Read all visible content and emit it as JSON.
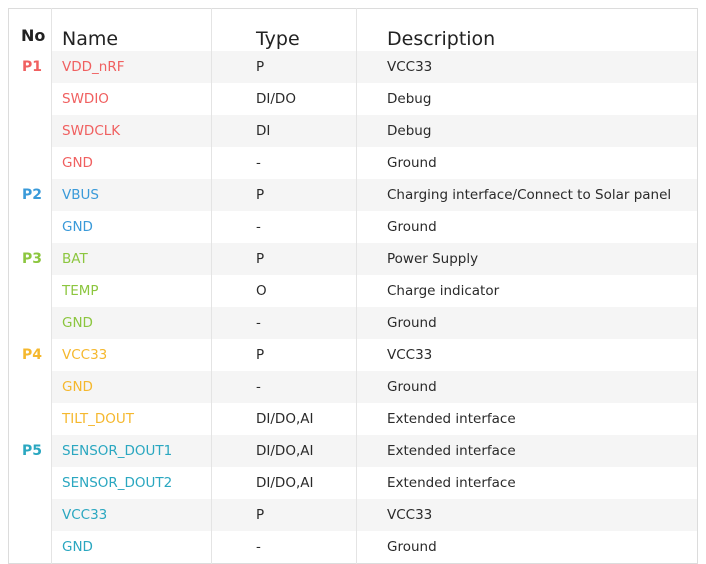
{
  "header": {
    "no": "No",
    "name": "Name",
    "type": "Type",
    "description": "Description"
  },
  "colors": {
    "P1": "#f06060",
    "P2": "#3a9ad9",
    "P3": "#8cc63f",
    "P4": "#f5b82e",
    "P5": "#2aa7c0"
  },
  "rows": [
    {
      "no": "P1",
      "group": "P1",
      "name": "VDD_nRF",
      "type": "P",
      "description": "VCC33"
    },
    {
      "no": "",
      "group": "P1",
      "name": "SWDIO",
      "type": "DI/DO",
      "description": "Debug"
    },
    {
      "no": "",
      "group": "P1",
      "name": "SWDCLK",
      "type": "DI",
      "description": "Debug"
    },
    {
      "no": "",
      "group": "P1",
      "name": "GND",
      "type": "-",
      "description": "Ground"
    },
    {
      "no": "P2",
      "group": "P2",
      "name": "VBUS",
      "type": "P",
      "description": "Charging interface/Connect to Solar panel"
    },
    {
      "no": "",
      "group": "P2",
      "name": "GND",
      "type": "-",
      "description": "Ground"
    },
    {
      "no": "P3",
      "group": "P3",
      "name": "BAT",
      "type": "P",
      "description": "Power Supply"
    },
    {
      "no": "",
      "group": "P3",
      "name": "TEMP",
      "type": "O",
      "description": "Charge indicator"
    },
    {
      "no": "",
      "group": "P3",
      "name": "GND",
      "type": "-",
      "description": "Ground"
    },
    {
      "no": "P4",
      "group": "P4",
      "name": "VCC33",
      "type": "P",
      "description": "VCC33"
    },
    {
      "no": "",
      "group": "P4",
      "name": "GND",
      "type": "-",
      "description": "Ground"
    },
    {
      "no": "",
      "group": "P4",
      "name": "TILT_DOUT",
      "type": "DI/DO,AI",
      "description": "Extended interface"
    },
    {
      "no": "P5",
      "group": "P5",
      "name": "SENSOR_DOUT1",
      "type": "DI/DO,AI",
      "description": "Extended interface"
    },
    {
      "no": "",
      "group": "P5",
      "name": "SENSOR_DOUT2",
      "type": "DI/DO,AI",
      "description": "Extended interface"
    },
    {
      "no": "",
      "group": "P5",
      "name": "VCC33",
      "type": "P",
      "description": "VCC33"
    },
    {
      "no": "",
      "group": "P5",
      "name": "GND",
      "type": "-",
      "description": "Ground"
    }
  ]
}
